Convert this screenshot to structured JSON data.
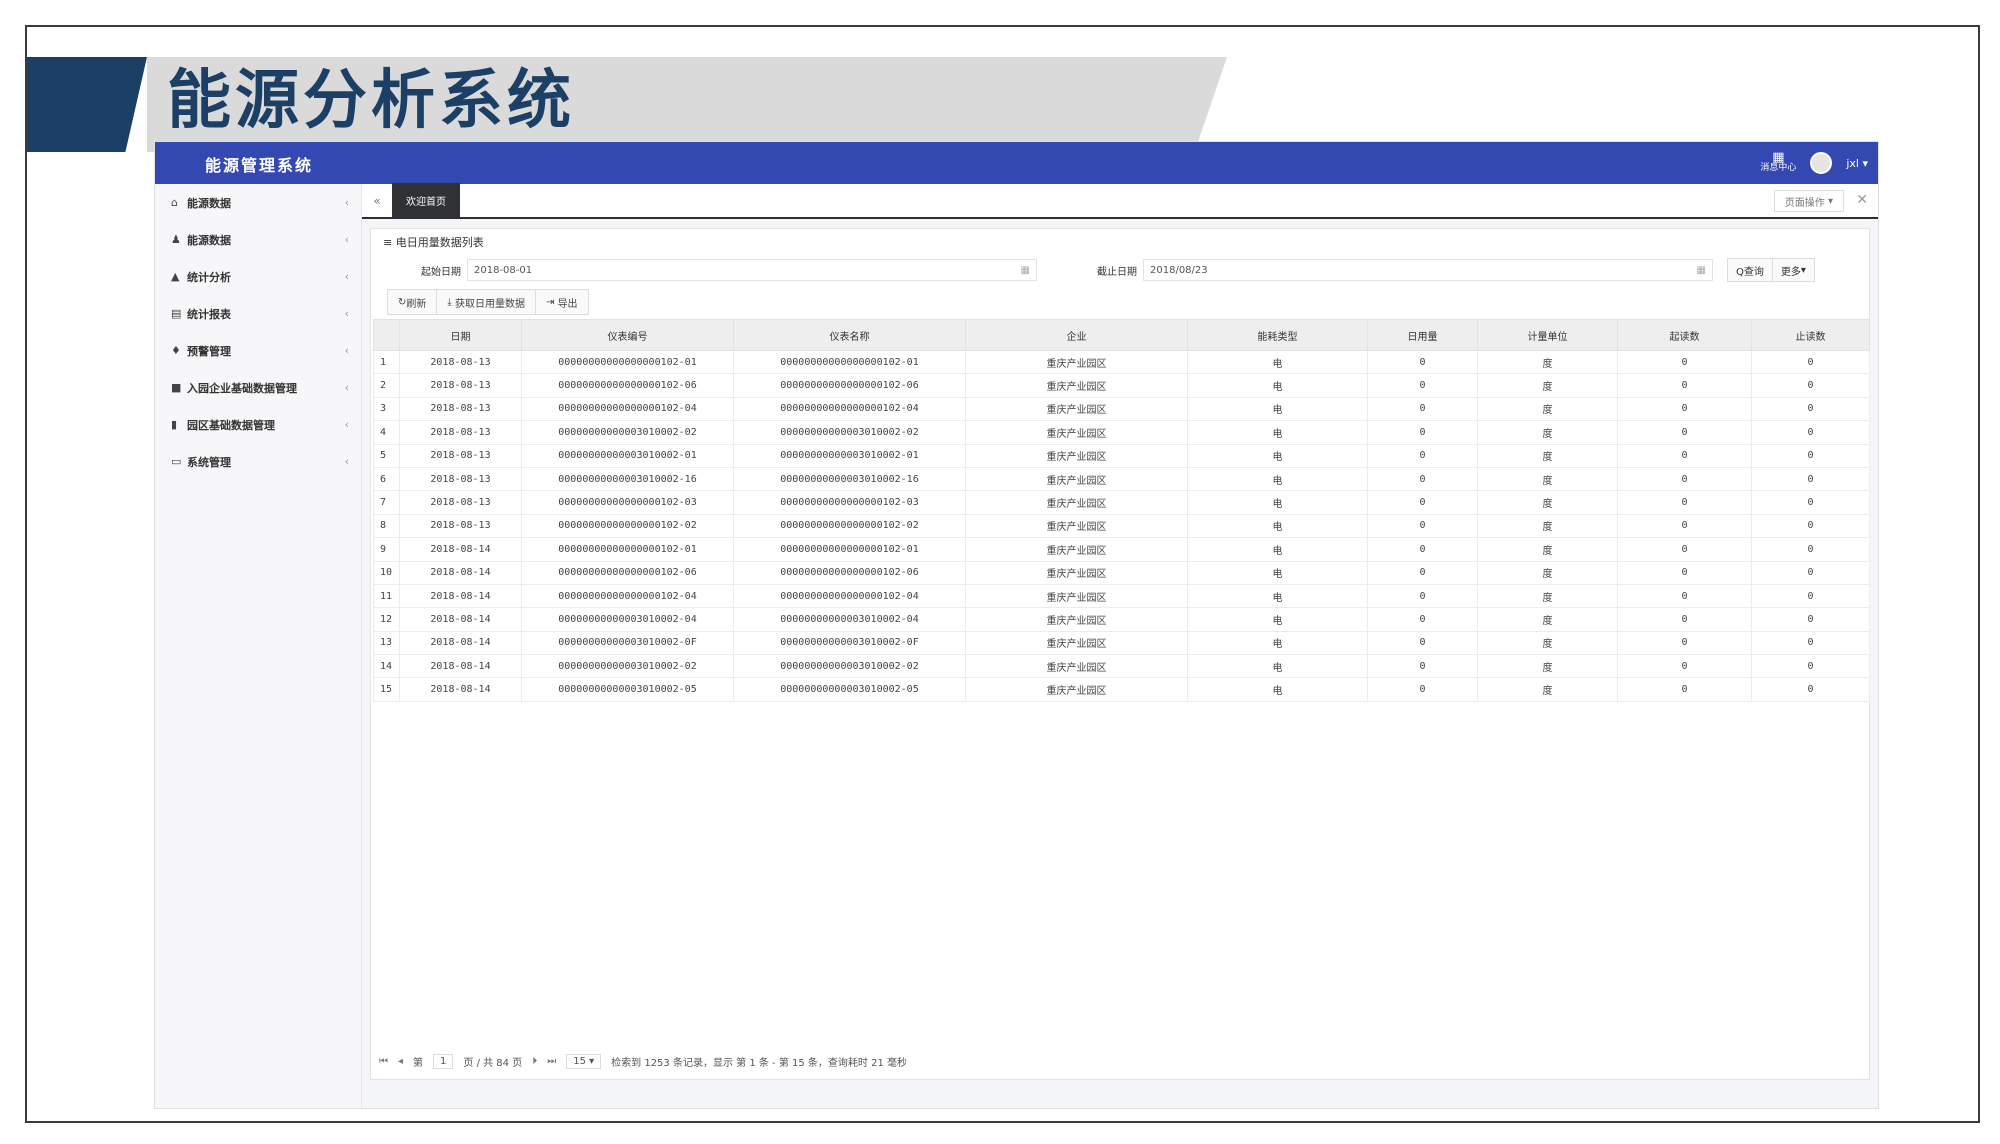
{
  "slide": {
    "title": "能源分析系统"
  },
  "app": {
    "brand": "能源管理系统",
    "message_center": "消息中心",
    "user": "jxl"
  },
  "sidebar": {
    "items": [
      {
        "label": "能源数据",
        "icon": "home-icon"
      },
      {
        "label": "能源数据",
        "icon": "user-icon"
      },
      {
        "label": "统计分析",
        "icon": "chart-icon"
      },
      {
        "label": "统计报表",
        "icon": "table-icon"
      },
      {
        "label": "预警管理",
        "icon": "bell-icon"
      },
      {
        "label": "入园企业基础数据管理",
        "icon": "folder-icon"
      },
      {
        "label": "园区基础数据管理",
        "icon": "file-icon"
      },
      {
        "label": "系统管理",
        "icon": "monitor-icon"
      }
    ]
  },
  "tabs": {
    "active": "欢迎首页",
    "ops": "页面操作",
    "nav_back": "«"
  },
  "panel": {
    "title": "电日用量数据列表"
  },
  "filter": {
    "start_label": "起始日期",
    "start_value": "2018-08-01",
    "end_label": "截止日期",
    "end_value": "2018/08/23",
    "query_button": "Q查询",
    "more_button": "更多"
  },
  "toolbar": {
    "refresh": "刷新",
    "fetch": "获取日用量数据",
    "export": "导出"
  },
  "table": {
    "columns": [
      "",
      "日期",
      "仪表编号",
      "仪表名称",
      "企业",
      "能耗类型",
      "日用量",
      "计量单位",
      "起读数",
      "止读数"
    ],
    "rows": [
      [
        "1",
        "2018-08-13",
        "00000000000000000102-01",
        "00000000000000000102-01",
        "重庆产业园区",
        "电",
        "0",
        "度",
        "0",
        "0"
      ],
      [
        "2",
        "2018-08-13",
        "00000000000000000102-06",
        "00000000000000000102-06",
        "重庆产业园区",
        "电",
        "0",
        "度",
        "0",
        "0"
      ],
      [
        "3",
        "2018-08-13",
        "00000000000000000102-04",
        "00000000000000000102-04",
        "重庆产业园区",
        "电",
        "0",
        "度",
        "0",
        "0"
      ],
      [
        "4",
        "2018-08-13",
        "00000000000003010002-02",
        "00000000000003010002-02",
        "重庆产业园区",
        "电",
        "0",
        "度",
        "0",
        "0"
      ],
      [
        "5",
        "2018-08-13",
        "00000000000003010002-01",
        "00000000000003010002-01",
        "重庆产业园区",
        "电",
        "0",
        "度",
        "0",
        "0"
      ],
      [
        "6",
        "2018-08-13",
        "00000000000003010002-16",
        "00000000000003010002-16",
        "重庆产业园区",
        "电",
        "0",
        "度",
        "0",
        "0"
      ],
      [
        "7",
        "2018-08-13",
        "00000000000000000102-03",
        "00000000000000000102-03",
        "重庆产业园区",
        "电",
        "0",
        "度",
        "0",
        "0"
      ],
      [
        "8",
        "2018-08-13",
        "00000000000000000102-02",
        "00000000000000000102-02",
        "重庆产业园区",
        "电",
        "0",
        "度",
        "0",
        "0"
      ],
      [
        "9",
        "2018-08-14",
        "00000000000000000102-01",
        "00000000000000000102-01",
        "重庆产业园区",
        "电",
        "0",
        "度",
        "0",
        "0"
      ],
      [
        "10",
        "2018-08-14",
        "00000000000000000102-06",
        "00000000000000000102-06",
        "重庆产业园区",
        "电",
        "0",
        "度",
        "0",
        "0"
      ],
      [
        "11",
        "2018-08-14",
        "00000000000000000102-04",
        "00000000000000000102-04",
        "重庆产业园区",
        "电",
        "0",
        "度",
        "0",
        "0"
      ],
      [
        "12",
        "2018-08-14",
        "00000000000003010002-04",
        "00000000000003010002-04",
        "重庆产业园区",
        "电",
        "0",
        "度",
        "0",
        "0"
      ],
      [
        "13",
        "2018-08-14",
        "00000000000003010002-0F",
        "00000000000003010002-0F",
        "重庆产业园区",
        "电",
        "0",
        "度",
        "0",
        "0"
      ],
      [
        "14",
        "2018-08-14",
        "00000000000003010002-02",
        "00000000000003010002-02",
        "重庆产业园区",
        "电",
        "0",
        "度",
        "0",
        "0"
      ],
      [
        "15",
        "2018-08-14",
        "00000000000003010002-05",
        "00000000000003010002-05",
        "重庆产业园区",
        "电",
        "0",
        "度",
        "0",
        "0"
      ]
    ]
  },
  "pager": {
    "page_prefix": "第",
    "page": "1",
    "page_suffix": "页 / 共 84 页",
    "page_size": "15",
    "summary": "检索到 1253 条记录，显示 第 1 条 - 第 15 条，查询耗时 21 毫秒"
  },
  "colors": {
    "topbar": "#3448b2",
    "title": "#1c3f66"
  }
}
